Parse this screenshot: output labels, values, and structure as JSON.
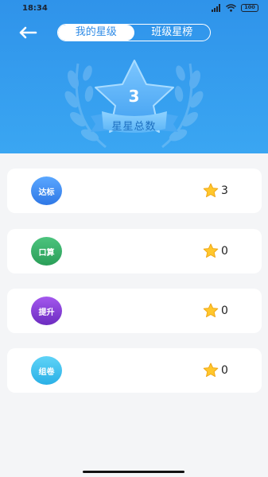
{
  "status_bar": {
    "time": "18:34",
    "battery": "100"
  },
  "header": {
    "tabs": [
      {
        "label": "我的星级",
        "active": true
      },
      {
        "label": "班级星榜",
        "active": false
      }
    ],
    "total_stars": "3",
    "total_label": "星星总数"
  },
  "items": [
    {
      "badge": "达标",
      "value": "3",
      "color": "#3f8cf0"
    },
    {
      "badge": "口算",
      "value": "0",
      "color": "#37b66c"
    },
    {
      "badge": "提升",
      "value": "0",
      "color": "#8a3fd8"
    },
    {
      "badge": "组卷",
      "value": "0",
      "color": "#3ec3ef"
    }
  ],
  "icons": {
    "back": "back-arrow-icon",
    "star": "star-icon"
  }
}
